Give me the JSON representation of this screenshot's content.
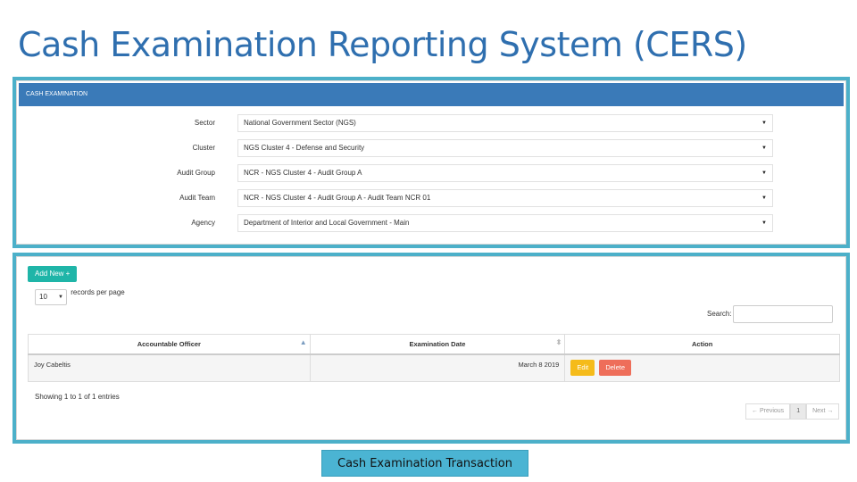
{
  "slide": {
    "title": "Cash Examination Reporting System (CERS)",
    "caption": "Cash Examination Transaction"
  },
  "panel": {
    "header": "CASH EXAMINATION",
    "fields": [
      {
        "label": "Sector",
        "value": "National Government Sector (NGS)"
      },
      {
        "label": "Cluster",
        "value": "NGS Cluster 4 - Defense and Security"
      },
      {
        "label": "Audit Group",
        "value": "NCR - NGS Cluster 4 - Audit Group A"
      },
      {
        "label": "Audit Team",
        "value": "NCR - NGS Cluster 4 - Audit Group A - Audit Team NCR 01"
      },
      {
        "label": "Agency",
        "value": "Department of Interior and Local Government - Main"
      }
    ]
  },
  "list": {
    "add_button": "Add New +",
    "records_per_page_value": "10",
    "records_per_page_label": "records per page",
    "search_label": "Search:",
    "columns": [
      "Accountable Officer",
      "Examination Date",
      "Action"
    ],
    "rows": [
      {
        "officer": "Joy Cabeltis",
        "date": "March 8 2019",
        "edit": "Edit",
        "delete": "Delete"
      }
    ],
    "showing": "Showing 1 to 1 of 1 entries",
    "pagination": {
      "previous": "← Previous",
      "page": "1",
      "next": "Next →"
    }
  },
  "colors": {
    "title": "#2f6faf",
    "frame": "#4cb0c9",
    "header": "#3a7ab8",
    "add_button": "#1fb5a8",
    "edit_button": "#f5bb1a",
    "delete_button": "#ee6e5a",
    "caption": "#4bb4d3"
  }
}
